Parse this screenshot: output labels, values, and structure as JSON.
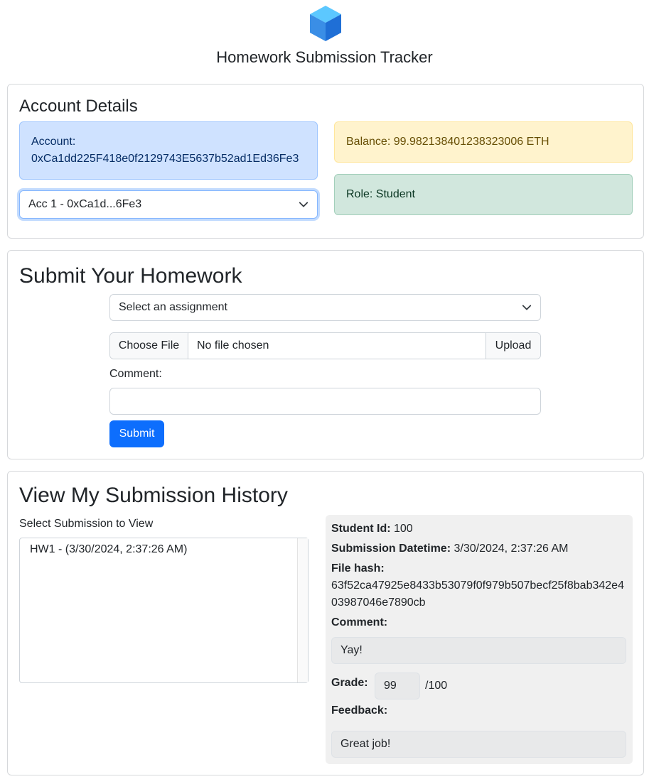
{
  "app": {
    "title": "Homework Submission Tracker",
    "logo_icon": "blue-cube-icon"
  },
  "account": {
    "heading": "Account Details",
    "account_label": "Account:",
    "address": "0xCa1dd225F418e0f2129743E5637b52ad1Ed36Fe3",
    "selected_account": "Acc 1 - 0xCa1d...6Fe3",
    "balance": "Balance: 99.982138401238323006 ETH",
    "role": "Role: Student"
  },
  "submit": {
    "heading": "Submit Your Homework",
    "assignment_placeholder": "Select an assignment",
    "choose_file": "Choose File",
    "file_status": "No file chosen",
    "upload": "Upload",
    "comment_label": "Comment:",
    "comment_value": "",
    "submit_button": "Submit"
  },
  "history": {
    "heading": "View My Submission History",
    "select_label": "Select Submission to View",
    "submissions": [
      "HW1 - (3/30/2024, 2:37:26 AM)"
    ],
    "detail": {
      "student_id_label": "Student Id:",
      "student_id": "100",
      "datetime_label": "Submission Datetime:",
      "datetime": "3/30/2024, 2:37:26 AM",
      "hash_label": "File hash:",
      "hash": "63f52ca47925e8433b53079f0f979b507becf25f8bab342e403987046e7890cb",
      "comment_label": "Comment:",
      "comment": "Yay!",
      "grade_label": "Grade:",
      "grade": "99",
      "grade_max": "/100",
      "feedback_label": "Feedback:",
      "feedback": "Great job!"
    }
  },
  "colors": {
    "primary": "#0d6efd",
    "info_bg": "#cfe2ff",
    "warning_bg": "#fff3cd",
    "success_bg": "#d1e7dd"
  }
}
